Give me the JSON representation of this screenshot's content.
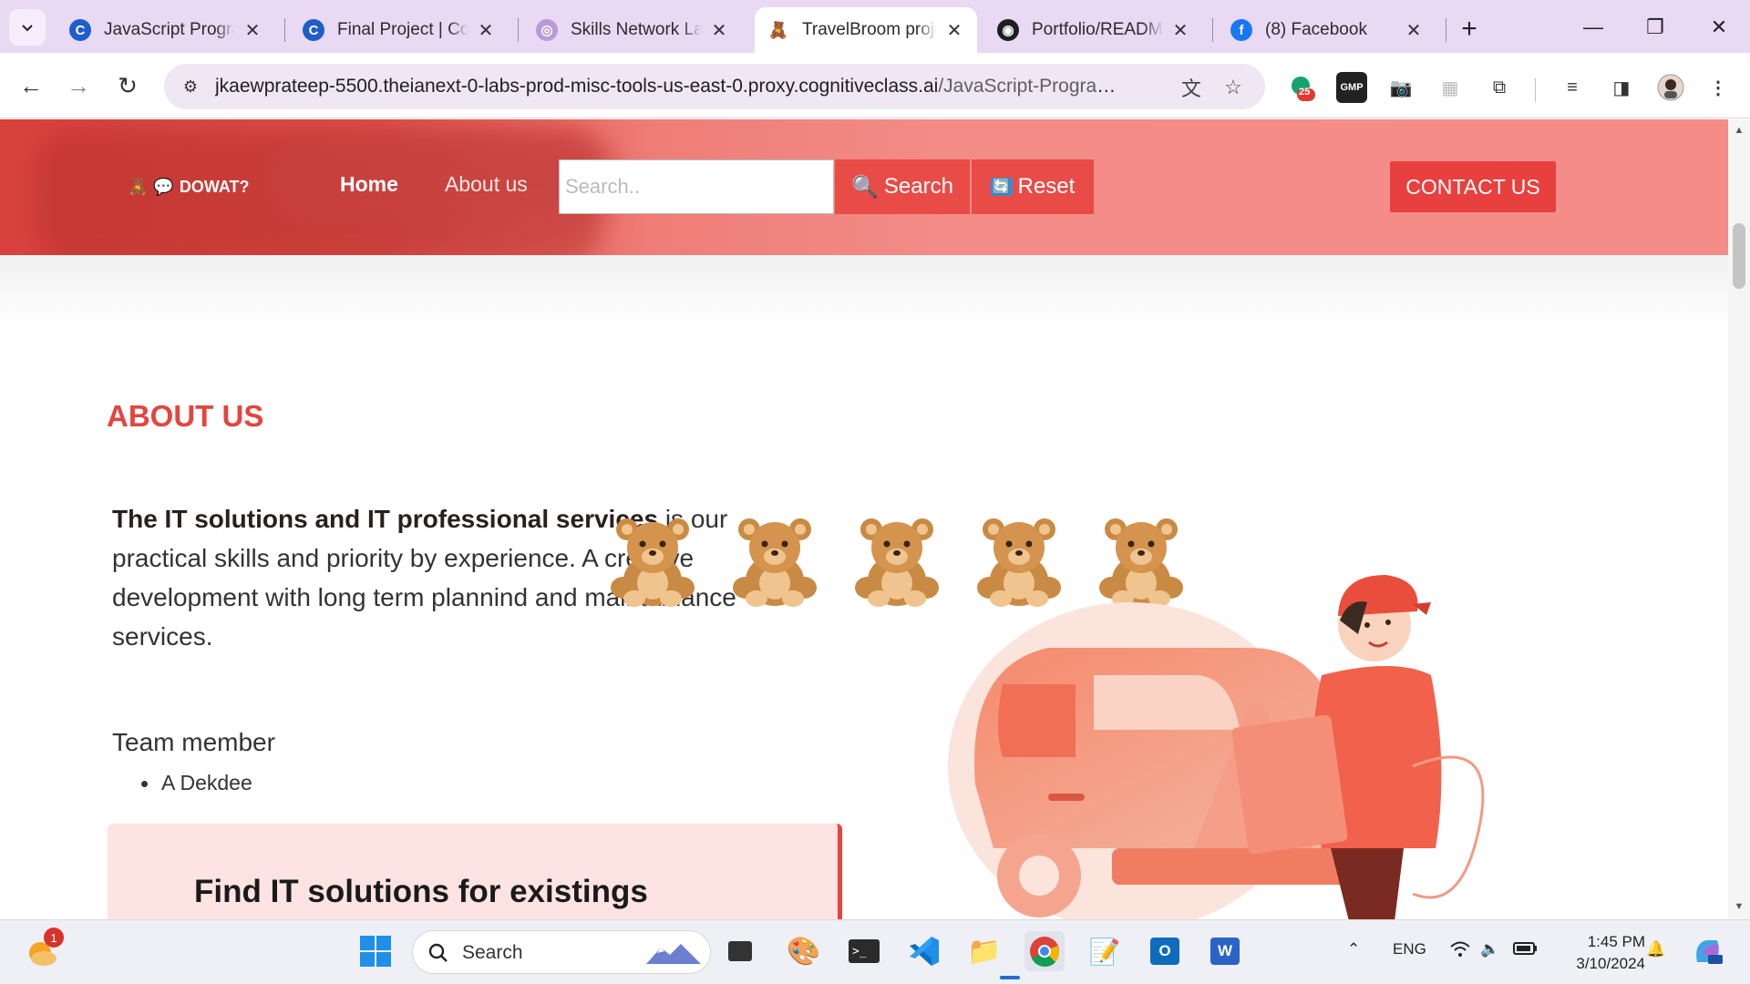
{
  "browser": {
    "tabs": [
      {
        "title": "JavaScript Programm",
        "icon": "coursera-icon",
        "active": false
      },
      {
        "title": "Final Project | Course",
        "icon": "coursera-icon",
        "active": false
      },
      {
        "title": "Skills Network Labs",
        "icon": "skills-network-icon",
        "active": false
      },
      {
        "title": "TravelBroom project",
        "icon": "teddy-bear-icon",
        "active": true
      },
      {
        "title": "Portfolio/README",
        "icon": "github-icon",
        "active": false
      },
      {
        "title": "(8) Facebook",
        "icon": "facebook-icon",
        "active": false
      }
    ],
    "url_main": "jkaewprateep-5500.theianext-0-labs-prod-misc-tools-us-east-0.proxy.cognitiveclass.ai",
    "url_path": "/JavaScript-Programming...",
    "extension_badge": "25",
    "extension_gmp": "GMP"
  },
  "site": {
    "brand": "DOWAT?",
    "nav_home": "Home",
    "nav_about": "About us",
    "search_placeholder": "Search..",
    "search_button": "Search",
    "reset_button": "Reset",
    "contact_button": "CONTACT US"
  },
  "about": {
    "heading": "ABOUT US",
    "bold_lead": "The IT solutions and IT professional services",
    "body": " is our practical skills and priority by experience. A creative development with long term plannind and maintainance services.",
    "team_label": "Team member",
    "team_members": [
      "A Dekdee"
    ],
    "card_title": "Find IT solutions for existings"
  },
  "taskbar": {
    "weather_badge": "1",
    "search_label": "Search",
    "language": "ENG",
    "time": "1:45 PM",
    "date": "3/10/2024"
  },
  "colors": {
    "brand_red": "#e5443f",
    "nav_pink": "#f48d88",
    "tab_strip": "#e9d9f3"
  }
}
